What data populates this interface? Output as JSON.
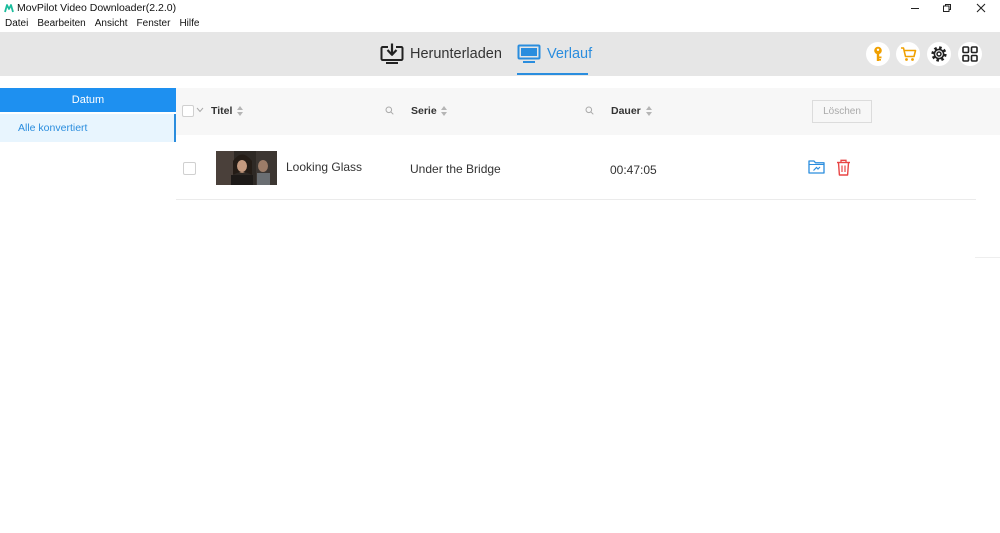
{
  "window": {
    "title": "MovPilot Video Downloader(2.2.0)"
  },
  "menu": [
    "Datei",
    "Bearbeiten",
    "Ansicht",
    "Fenster",
    "Hilfe"
  ],
  "toolbar": {
    "tabs": [
      {
        "label": "Herunterladen",
        "icon": "download-icon",
        "active": false
      },
      {
        "label": "Verlauf",
        "icon": "monitor-icon",
        "active": true
      }
    ],
    "right_icons": [
      "key-icon",
      "cart-icon",
      "gear-icon",
      "grid-icon"
    ]
  },
  "sidebar": {
    "header": "Datum",
    "items": [
      {
        "label": "Alle konvertiert",
        "selected": true
      }
    ]
  },
  "table": {
    "columns": [
      "Titel",
      "Serie",
      "Dauer"
    ],
    "delete_all_label": "Löschen",
    "rows": [
      {
        "title": "Looking Glass",
        "series": "Under the Bridge",
        "duration": "00:47:05"
      }
    ]
  },
  "colors": {
    "accent": "#2a8dde",
    "sidebar_header": "#1e90f0",
    "toolbar_bg": "#e6e6e6",
    "icon_orange": "#f0a000",
    "delete_red": "#e84545"
  }
}
